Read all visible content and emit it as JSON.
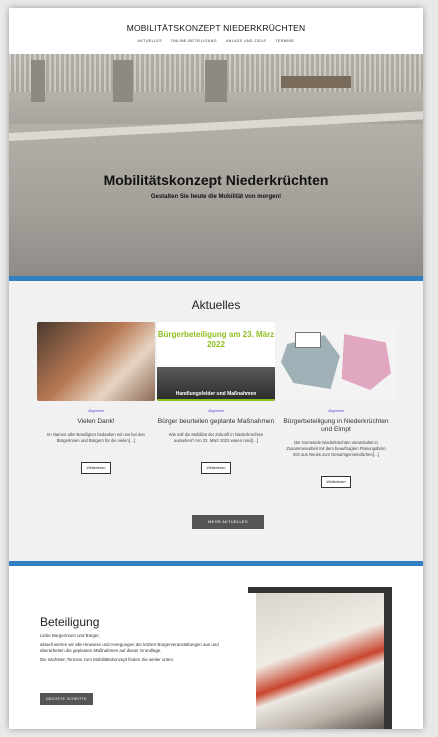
{
  "header": {
    "site_title": "MOBILITÄTSKONZEPT NIEDERKRÜCHTEN",
    "nav": [
      "AKTUELLES",
      "ONLINE-BETEILIGUNG",
      "ANLASS UND ZIELE",
      "TERMINE"
    ]
  },
  "hero": {
    "title": "Mobilitätskonzept Niederkrüchten",
    "subtitle": "Gestalten Sie heute die Mobilität von morgen!"
  },
  "news": {
    "heading": "Aktuelles",
    "cards": [
      {
        "category": "Allgemein",
        "title": "Vielen Dank!",
        "excerpt": "Im Namen aller Beteiligten bedanken wir uns bei den Bürgerinnen und Bürgern für die vielen[…]",
        "button": "Weiterlesen"
      },
      {
        "category": "Allgemein",
        "thumb_text": "Bürgerbeteiligung am 23. März 2022",
        "thumb_label": "Handlungsfelder und Maßnahmen",
        "title": "Bürger beurteilen geplante Maßnahmen",
        "excerpt": "Wie soll die Mobilität der Zukunft in Niederkrüchten aussehen? Am 23. März 2022 waren rund[…]",
        "button": "Weiterlesen"
      },
      {
        "category": "Allgemein",
        "title": "Bürgerbeteiligung in Niederkrüchten und Elmpt",
        "excerpt": "Die Gemeinde Niederkrüchten veranstaltet in Zusammenarbeit mit dem beauftragten Planungsbüro IGS aus Neuss zum Gesamtgemeindlichen[…]",
        "button": "Weiterlesen"
      }
    ],
    "more_button": "MEHR AKTUELLES"
  },
  "participation": {
    "title": "Beteiligung",
    "paragraphs": [
      "Liebe Bürgerinnen und Bürger,",
      "aktuell werten wir alle Hinweise und Anregungen der letzten Bürgerveranstaltungen aus und überarbeiten die geplanten Maßnahmen auf dieser Grundlage.",
      "Die nächsten Termine zum Mobilitätskonzept finden Sie weiter unten."
    ],
    "button": "NÄCHSTE SCHRITTE"
  },
  "colors": {
    "accent_blue": "#2f7fc1",
    "category_purple": "#6a3fd0",
    "thumb_green": "#8bbf1f",
    "button_dark": "#555555"
  }
}
